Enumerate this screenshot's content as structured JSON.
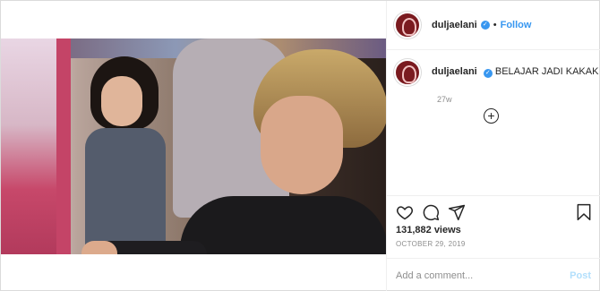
{
  "post": {
    "username": "duljaelani",
    "follow_label": "Follow",
    "separator": "•",
    "caption_text": "BELAJAR JADI KAKAK",
    "time_ago": "27w",
    "views": "131,882 views",
    "date": "OCTOBER 29, 2019"
  },
  "comment": {
    "placeholder": "Add a comment...",
    "post_label": "Post"
  },
  "icons": {
    "like": "heart-icon",
    "comment": "comment-icon",
    "share": "share-icon",
    "save": "bookmark-icon",
    "more": "plus-circle-icon",
    "verified": "verified-badge-icon"
  },
  "colors": {
    "accent": "#3897f0",
    "post_disabled": "#b2dffc",
    "muted": "#8e8e8e",
    "text": "#262626"
  }
}
